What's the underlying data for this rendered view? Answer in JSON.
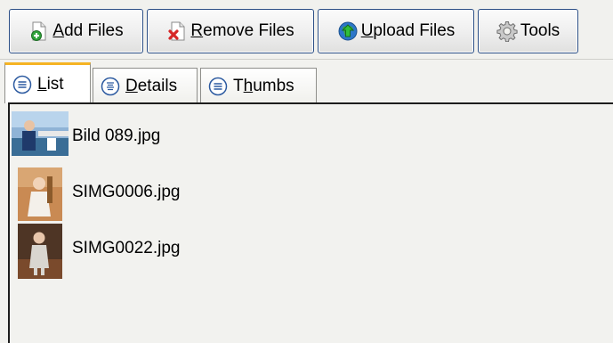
{
  "toolbar": {
    "add_files": {
      "underline": "A",
      "rest": "dd Files",
      "icon": "add-file-icon"
    },
    "remove_files": {
      "underline": "R",
      "rest": "emove Files",
      "icon": "remove-file-icon"
    },
    "upload_files": {
      "underline": "U",
      "rest": "pload Files",
      "icon": "upload-globe-icon"
    },
    "tools": {
      "label": "Tools",
      "icon": "gear-icon"
    }
  },
  "tabs": [
    {
      "pre": "",
      "underline": "L",
      "post": "ist",
      "active": true,
      "icon": "list-view-icon"
    },
    {
      "pre": "",
      "underline": "D",
      "post": "etails",
      "active": false,
      "icon": "details-view-icon"
    },
    {
      "pre": "T",
      "underline": "h",
      "post": "umbs",
      "active": false,
      "icon": "thumbs-view-icon"
    }
  ],
  "files": [
    {
      "name": "Bild 089.jpg",
      "thumb": "photo-thumbnail"
    },
    {
      "name": "SIMG0006.jpg",
      "thumb": "photo-thumbnail"
    },
    {
      "name": "SIMG0022.jpg",
      "thumb": "photo-thumbnail"
    }
  ],
  "colors": {
    "accent_tab": "#f5b323",
    "button_border": "#2c4f86",
    "background": "#f2f2ef"
  }
}
